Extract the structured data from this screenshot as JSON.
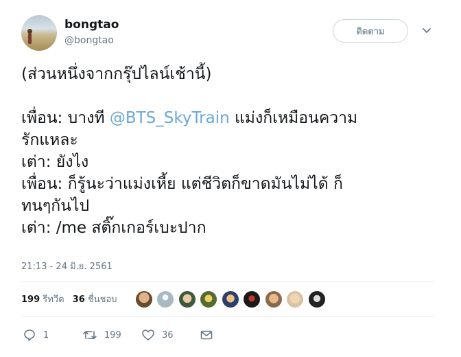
{
  "user": {
    "display_name": "bongtao",
    "username": "@bongtao"
  },
  "follow_button_label": "ติดตาม",
  "tweet": {
    "line1": "(ส่วนหนึ่งจากกรุ๊ปไลน์เช้านี้)",
    "line2_prefix": "เพื่อน: บางที ",
    "mention": "@BTS_SkyTrain",
    "line2_suffix": " แม่งก็เหมือนความ",
    "line3": "รักแหละ",
    "line4": "เต่า: ยังไง",
    "line5": "เพื่อน: ก็รู้นะว่าแม่งเหี้ย แต่ชีวิตก็ขาดมันไม่ได้ ก็",
    "line6": "ทนๆกันไป",
    "line7": "เต่า: /me สติ๊กเกอร์เบะปาก"
  },
  "timestamp": "21:13 - 24 มิ.ย. 2561",
  "stats": {
    "retweets_count": "199",
    "retweets_label": "รีทวีต",
    "likes_count": "36",
    "likes_label": "ชื่นชอบ"
  },
  "actions": {
    "reply_count": "1",
    "retweet_count": "199",
    "like_count": "36"
  },
  "colors": {
    "mention": "#6aa8d8",
    "secondary_text": "#657786",
    "divider": "#e6ecf0"
  },
  "icons": [
    "chevron-down-icon",
    "reply-icon",
    "retweet-icon",
    "heart-icon",
    "envelope-icon"
  ]
}
